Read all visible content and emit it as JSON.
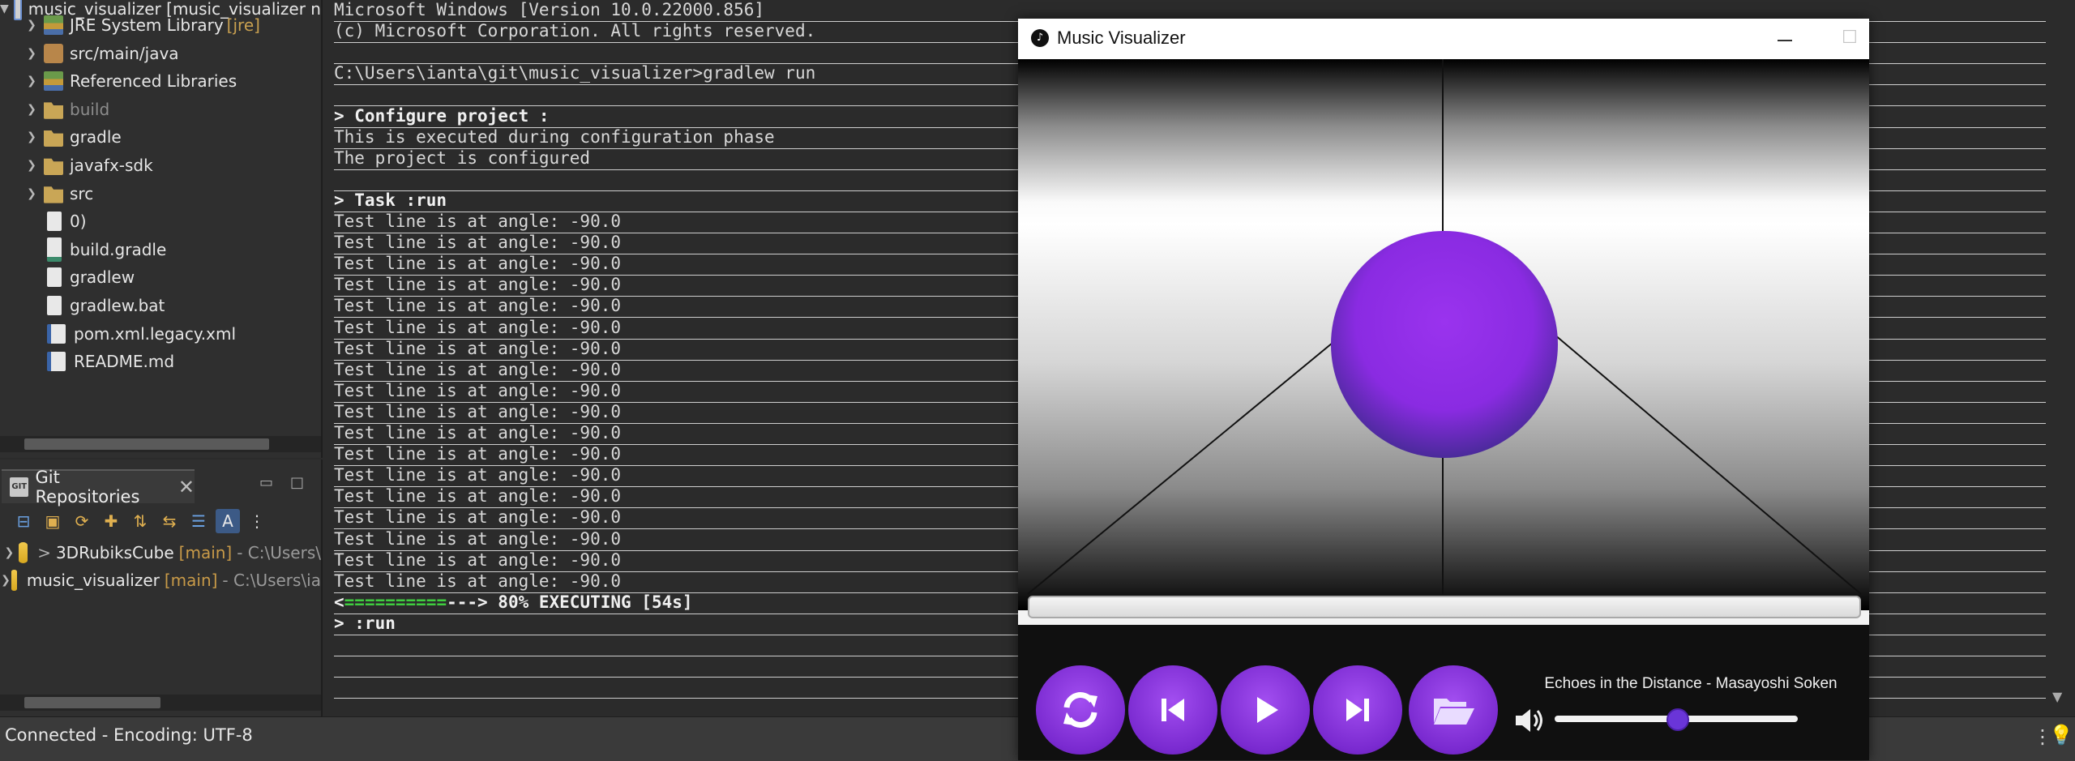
{
  "explorer": {
    "project": {
      "label": "music_visualizer [music_visualizer n"
    },
    "items": [
      {
        "label": "JRE System Library",
        "decoration": "[jre]",
        "icon": "library-icon"
      },
      {
        "label": "src/main/java",
        "icon": "package-folder-icon"
      },
      {
        "label": "Referenced Libraries",
        "icon": "library-icon"
      },
      {
        "label": "build",
        "icon": "folder-icon"
      },
      {
        "label": "gradle",
        "icon": "folder-icon"
      },
      {
        "label": "javafx-sdk",
        "icon": "folder-icon"
      },
      {
        "label": "src",
        "icon": "folder-icon"
      },
      {
        "label": "0)",
        "icon": "file-icon"
      },
      {
        "label": "build.gradle",
        "icon": "gradle-file-icon"
      },
      {
        "label": "gradlew",
        "icon": "file-icon"
      },
      {
        "label": "gradlew.bat",
        "icon": "file-icon"
      },
      {
        "label": "pom.xml.legacy.xml",
        "icon": "xml-file-icon"
      },
      {
        "label": "README.md",
        "icon": "markdown-file-icon"
      }
    ]
  },
  "git": {
    "tab_label": "Git Repositories",
    "repos": [
      {
        "prefix": ">",
        "name": "3DRubiksCube",
        "branch": "[main]",
        "path": "- C:\\Users\\"
      },
      {
        "prefix": "",
        "name": "music_visualizer",
        "branch": "[main]",
        "path": "- C:\\Users\\ia"
      }
    ]
  },
  "console": {
    "header_lines": [
      "Microsoft Windows [Version 10.0.22000.856]",
      "(c) Microsoft Corporation. All rights reserved.",
      "",
      "C:\\Users\\ianta\\git\\music_visualizer>gradlew run",
      ""
    ],
    "configure_label": "> Configure project :",
    "configure_lines": [
      "This is executed during configuration phase",
      "The project is configured",
      ""
    ],
    "task_label": "> Task :run",
    "test_line": "Test line is at angle: -90.0",
    "test_line_count": 18,
    "progress_open": "<",
    "progress_done": "==========",
    "progress_rest": "---> 80% EXECUTING [54s]",
    "run_label": "> :run"
  },
  "visualizer": {
    "window_title": "Music Visualizer",
    "song": "Echoes in the Distance - Masayoshi Soken",
    "volume": 0.5,
    "accent_color": "#8a2be2",
    "buttons": [
      "repeat-icon",
      "previous-icon",
      "play-icon",
      "next-icon",
      "open-folder-icon"
    ]
  },
  "status": {
    "text": "Connected - Encoding: UTF-8"
  }
}
